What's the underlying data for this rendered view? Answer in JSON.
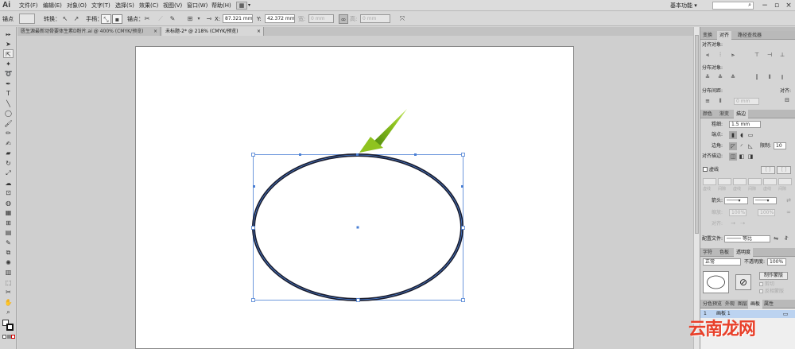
{
  "app": {
    "logo_text": "Ai"
  },
  "menubar": {
    "items": [
      "文件(F)",
      "编辑(E)",
      "对象(O)",
      "文字(T)",
      "选择(S)",
      "效果(C)",
      "视图(V)",
      "窗口(W)",
      "帮助(H)"
    ],
    "workspace_label": "基本功能",
    "workspace_arrow": "▾",
    "search_icon": "search-icon"
  },
  "controlbar": {
    "selection_label": "锚点",
    "convert_label": "转换：",
    "handles_label": "手柄：",
    "anchors_label": "锚点：",
    "x_label": "X:",
    "x_value": "87.321 mm",
    "y_label": "Y:",
    "y_value": "42.372 mm",
    "w_label": "宽:",
    "w_value": "0 mm",
    "h_label": "高:",
    "h_value": "0 mm"
  },
  "tabs": [
    {
      "label": "匮生源最新动骨要体生素D粉片.ai @ 400% (CMYK/预览)",
      "close": "×",
      "active": false
    },
    {
      "label": "未标题-2* @ 218% (CMYK/预览)",
      "close": "×",
      "active": true
    }
  ],
  "panels": {
    "align": {
      "tabs": [
        "变换",
        "对齐",
        "路径查找器"
      ],
      "active_tab": 1,
      "align_objects_label": "对齐对象:",
      "distribute_objects_label": "分布对象:",
      "distribute_spacing_label": "分布间距:",
      "align_to_label": "对齐:",
      "spacing_value": "0 mm"
    },
    "stroke": {
      "tabs": [
        "颜色",
        "渐变",
        "描边"
      ],
      "active_tab": 2,
      "weight_label": "粗细:",
      "weight_value": "1.5 mm",
      "cap_label": "端点:",
      "corner_label": "边角:",
      "limit_label": "限制:",
      "limit_value": "10",
      "align_stroke_label": "对齐描边:",
      "dashed_label": "虚线",
      "dash_labels": [
        "虚线",
        "间隙",
        "虚线",
        "间隙",
        "虚线",
        "间隙"
      ],
      "arrowheads_label": "箭头:",
      "scale_label": "缩放:",
      "scale_value_1": "100%",
      "scale_value_2": "100%",
      "align_label": "对齐:",
      "profile_label": "配置文件:",
      "profile_value": "等比"
    },
    "transparency": {
      "tabs": [
        "字符",
        "色板",
        "透明度"
      ],
      "active_tab": 2,
      "mode_value": "正常",
      "opacity_label": "不透明度:",
      "opacity_value": "100%",
      "make_mask_label": "制作蒙版",
      "clip_label": "剪切",
      "invert_label": "反相蒙版"
    },
    "layers": {
      "tabs": [
        "分色预览",
        "外观",
        "图层",
        "画板",
        "属性"
      ],
      "active_tab": 3,
      "artboard_index": "1",
      "artboard_name": "画板 1"
    }
  },
  "watermark": "云南龙网",
  "colors": {
    "accent_green": "#8fc31f",
    "selection_blue": "#4a7fd4",
    "stroke_dark": "#1a1d2e"
  }
}
